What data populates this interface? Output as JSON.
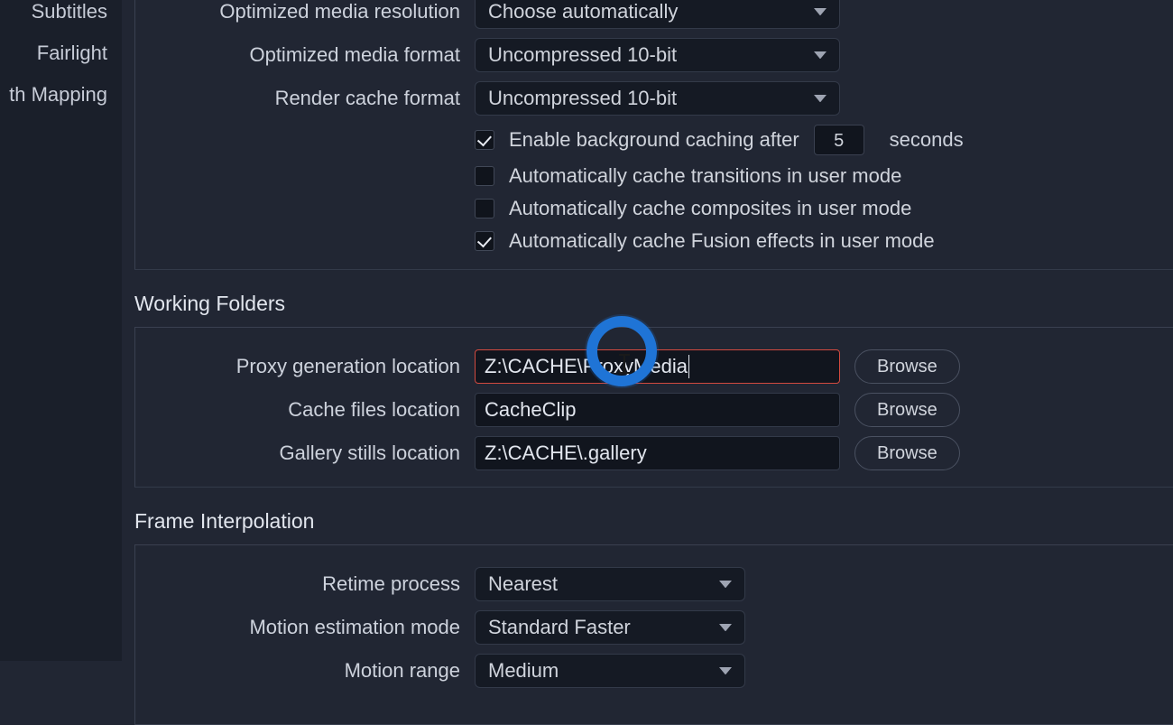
{
  "sidebar": {
    "items": [
      {
        "label": "Subtitles"
      },
      {
        "label": "Fairlight"
      },
      {
        "label": "th Mapping"
      }
    ]
  },
  "optimized": {
    "resolution_label": "Optimized media resolution",
    "resolution_value": "Choose automatically",
    "format_label": "Optimized media format",
    "format_value": "Uncompressed 10-bit",
    "render_cache_label": "Render cache format",
    "render_cache_value": "Uncompressed 10-bit",
    "bg_cache_label": "Enable background caching after",
    "bg_cache_value": "5",
    "bg_cache_suffix": "seconds",
    "auto_transitions_label": "Automatically cache transitions in user mode",
    "auto_composites_label": "Automatically cache composites in user mode",
    "auto_fusion_label": "Automatically cache Fusion effects in user mode"
  },
  "working_folders": {
    "title": "Working Folders",
    "proxy_label": "Proxy generation location",
    "proxy_value": "Z:\\CACHE\\ProxyMedia",
    "cache_label": "Cache files location",
    "cache_value": "CacheClip",
    "gallery_label": "Gallery stills location",
    "gallery_value": "Z:\\CACHE\\.gallery",
    "browse": "Browse"
  },
  "frame_interp": {
    "title": "Frame Interpolation",
    "retime_label": "Retime process",
    "retime_value": "Nearest",
    "motion_est_label": "Motion estimation mode",
    "motion_est_value": "Standard Faster",
    "motion_range_label": "Motion range",
    "motion_range_value": "Medium"
  }
}
